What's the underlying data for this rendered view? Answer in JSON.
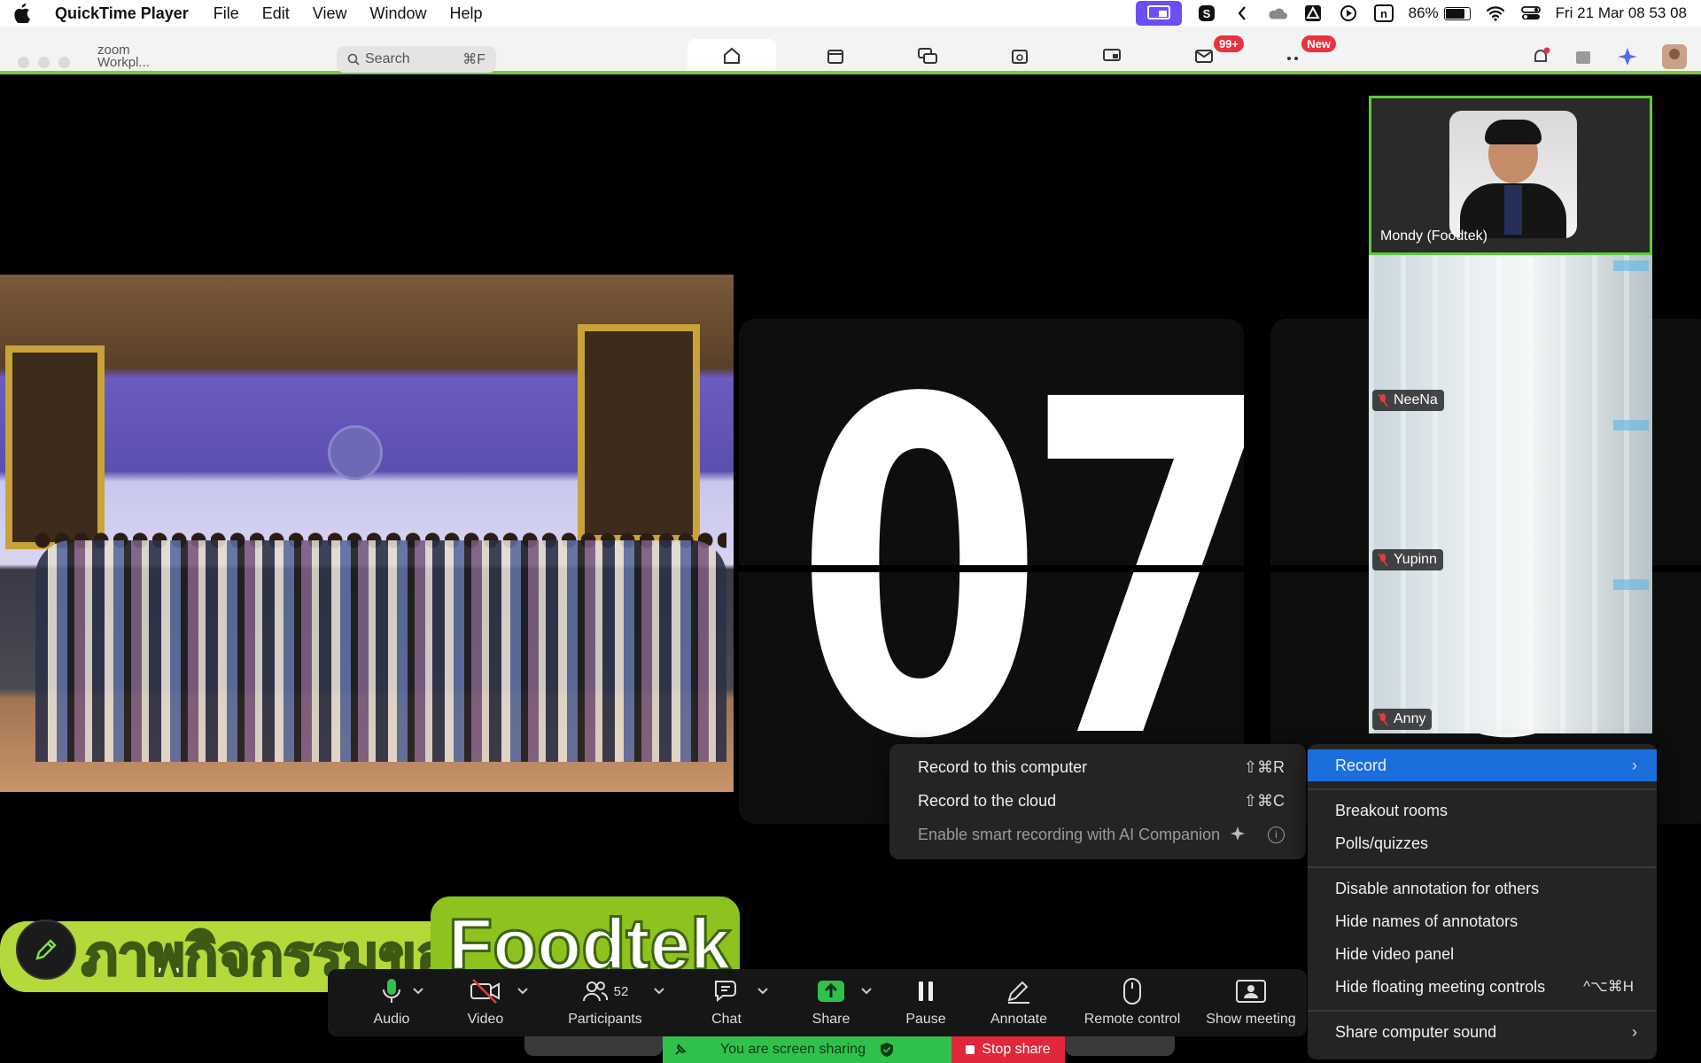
{
  "menubar": {
    "app_name": "QuickTime Player",
    "menus": [
      "File",
      "Edit",
      "View",
      "Window",
      "Help"
    ],
    "battery": "86%",
    "datetime": "Fri 21 Mar  08 53 08",
    "battery_level": 0.86
  },
  "zoom_window": {
    "logo_text": "zoom",
    "logo_sub": "Workpl...",
    "search_placeholder": "Search",
    "search_shortcut": "⌘F",
    "mail_badge": "99+",
    "new_badge": "New"
  },
  "slide": {
    "caption_thai": "ภาพกิจกรรมของ",
    "caption_en": "Foodtek",
    "clock_left": "07",
    "clock_right": "0"
  },
  "participants": [
    {
      "name": "Mondy (Foodtek)",
      "speaking": true,
      "muted": false
    },
    {
      "name": "NeeNa",
      "speaking": false,
      "muted": true
    },
    {
      "name": "Yupinn",
      "speaking": false,
      "muted": true
    },
    {
      "name": "Anny",
      "speaking": false,
      "muted": true
    }
  ],
  "more_menu": {
    "record": "Record",
    "breakout": "Breakout rooms",
    "polls": "Polls/quizzes",
    "disable_annotation": "Disable annotation for others",
    "hide_names": "Hide names of annotators",
    "hide_video_panel": "Hide video panel",
    "hide_floating": "Hide floating meeting controls",
    "hide_floating_shortcut": "^⌥⌘H",
    "share_sound": "Share computer sound"
  },
  "record_submenu": {
    "to_computer": "Record to this computer",
    "to_computer_shortcut": "⇧⌘R",
    "to_cloud": "Record to the cloud",
    "to_cloud_shortcut": "⇧⌘C",
    "smart": "Enable smart recording with AI Companion"
  },
  "controls": {
    "audio": "Audio",
    "video": "Video",
    "participants": "Participants",
    "participant_count": "52",
    "chat": "Chat",
    "share": "Share",
    "pause": "Pause",
    "annotate": "Annotate",
    "remote": "Remote control",
    "show_meeting": "Show meeting"
  },
  "share_status": {
    "sharing": "You are screen sharing",
    "stop": "Stop share"
  },
  "colors": {
    "accent_blue": "#1a6fdc",
    "share_green": "#2fc14b",
    "stop_red": "#e0283a",
    "speaker_border": "#5ecb3a"
  }
}
